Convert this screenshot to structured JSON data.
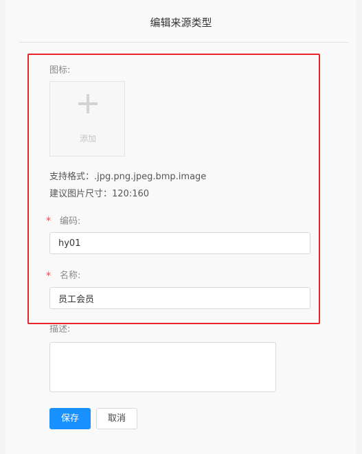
{
  "dialog": {
    "title": "编辑来源类型"
  },
  "form": {
    "icon": {
      "label": "图标:",
      "upload_text": "添加",
      "format_hint": "支持格式：.jpg.png.jpeg.bmp.image",
      "size_hint": "建议图片尺寸：120:160"
    },
    "code": {
      "required_mark": "*",
      "label": "编码:",
      "value": "hy01"
    },
    "name": {
      "required_mark": "*",
      "label": "名称:",
      "value": "员工会员"
    },
    "description": {
      "label": "描述:",
      "value": ""
    }
  },
  "buttons": {
    "save_label": "保存",
    "cancel_label": "取消"
  },
  "colors": {
    "primary": "#1890ff",
    "highlight_border": "#e8262a",
    "required": "#e84a4a"
  },
  "icons": {
    "upload": "plus-icon"
  }
}
